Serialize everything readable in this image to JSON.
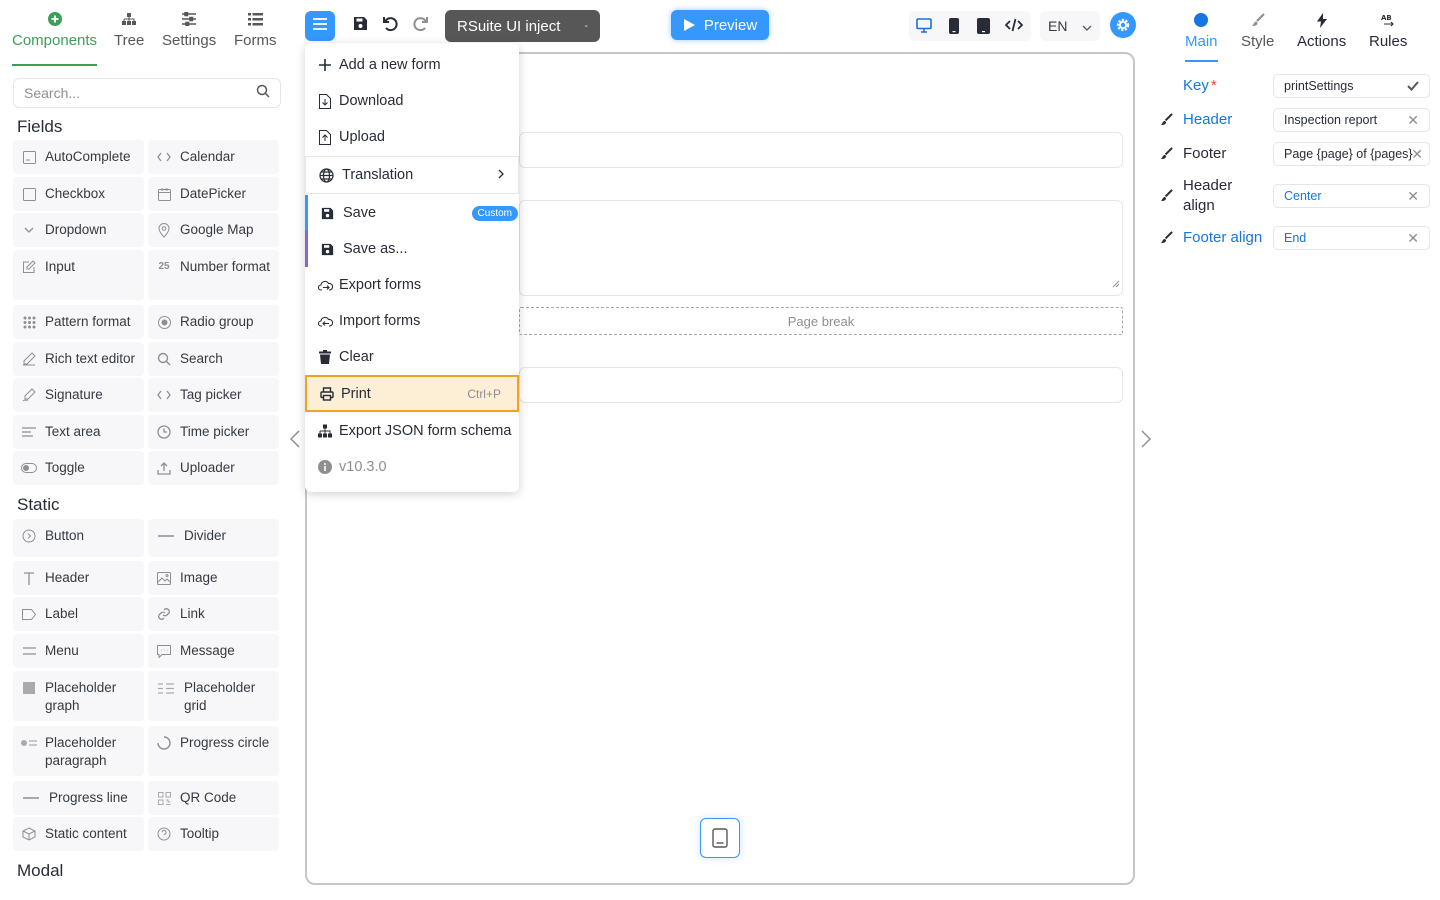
{
  "left_tabs": [
    {
      "label": "Components",
      "icon": "plus-circle-icon"
    },
    {
      "label": "Tree",
      "icon": "tree-icon"
    },
    {
      "label": "Settings",
      "icon": "sliders-icon"
    },
    {
      "label": "Forms",
      "icon": "list-icon"
    }
  ],
  "search": {
    "placeholder": "Search..."
  },
  "sections": {
    "fields": "Fields",
    "static": "Static",
    "modal": "Modal"
  },
  "fields": [
    "AutoComplete",
    "Calendar",
    "Checkbox",
    "DatePicker",
    "Dropdown",
    "Google Map",
    "Input",
    "Number format",
    "Pattern format",
    "Radio group",
    "Rich text editor",
    "Search",
    "Signature",
    "Tag picker",
    "Text area",
    "Time picker",
    "Toggle",
    "Uploader"
  ],
  "static_items": [
    "Button",
    "Divider",
    "Header",
    "Image",
    "Label",
    "Link",
    "Menu",
    "Message",
    "Placeholder graph",
    "Placeholder grid",
    "Placeholder paragraph",
    "Progress circle",
    "Progress line",
    "QR Code",
    "Static content",
    "Tooltip"
  ],
  "toolbar": {
    "context": "RSuite UI inject",
    "context_caret": "-",
    "preview": "Preview",
    "language": "EN"
  },
  "menu": {
    "add": "Add a new form",
    "download": "Download",
    "upload": "Upload",
    "translation": "Translation",
    "save": "Save",
    "save_badge": "Custom",
    "save_as": "Save as...",
    "export_forms": "Export forms",
    "import_forms": "Import forms",
    "clear": "Clear",
    "print": "Print",
    "print_shortcut": "Ctrl+P",
    "export_schema": "Export JSON form schema",
    "version": "v10.3.0"
  },
  "canvas": {
    "page_break": "Page break"
  },
  "right_tabs": [
    {
      "label": "Main",
      "icon": "circle-icon"
    },
    {
      "label": "Style",
      "icon": "brush-icon"
    },
    {
      "label": "Actions",
      "icon": "bolt-icon"
    },
    {
      "label": "Rules",
      "icon": "ab-icon"
    }
  ],
  "props": {
    "key_label": "Key",
    "key_required": "*",
    "key_value": "printSettings",
    "header_label": "Header",
    "header_value": "Inspection report",
    "footer_label": "Footer",
    "footer_value": "Page {page} of {pages}",
    "header_align_label": "Header align",
    "header_align_value": "Center",
    "footer_align_label": "Footer align",
    "footer_align_value": "End"
  },
  "colors": {
    "accent": "#3498ff",
    "components_green": "#3d9e5a",
    "print_highlight": "#f0a224"
  }
}
